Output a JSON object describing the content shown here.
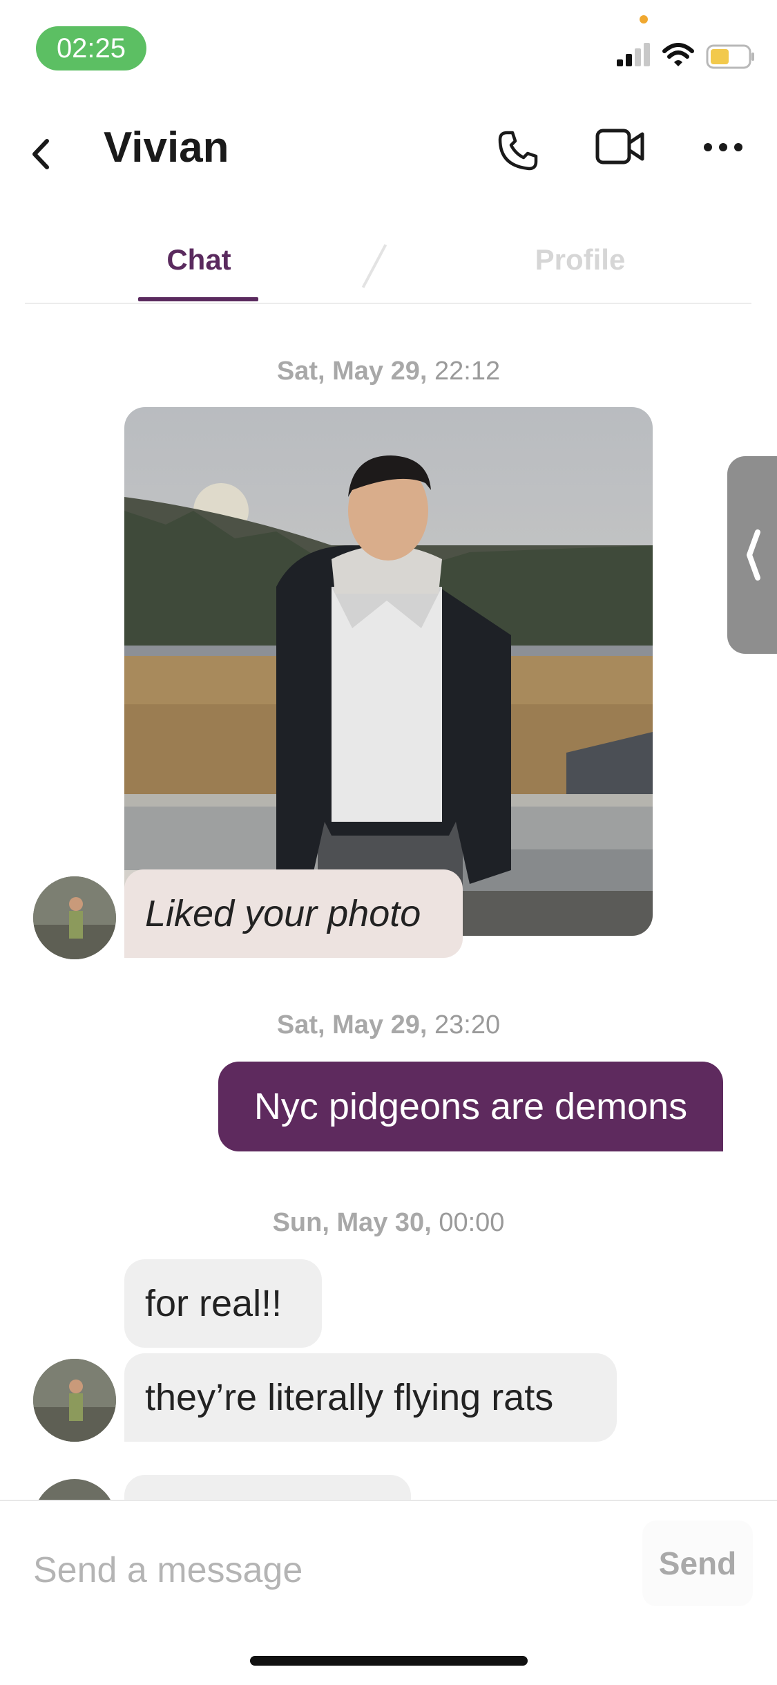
{
  "status_bar": {
    "time": "02:25"
  },
  "header": {
    "title": "Vivian"
  },
  "tabs": [
    {
      "label": "Chat",
      "active": true
    },
    {
      "label": "Profile",
      "active": false
    }
  ],
  "messages": [
    {
      "date": "Sat, May 29,",
      "time": "22:12",
      "type": "liked_photo",
      "text": "Liked your photo"
    },
    {
      "date": "Sat, May 29,",
      "time": "23:20",
      "type": "outgoing",
      "text": "Nyc pidgeons are demons"
    },
    {
      "date": "Sun, May 30,",
      "time": "00:00",
      "type": "incoming",
      "texts": [
        "for real!!",
        "they’re literally flying rats"
      ]
    }
  ],
  "composer": {
    "placeholder": "Send a message",
    "value": "",
    "send_label": "Send"
  },
  "colors": {
    "accent": "#5e2a5e",
    "time_pill": "#5cbf63",
    "incoming_bubble": "#efefef",
    "liked_bubble": "#ede3e0"
  },
  "icons": [
    "back-chevron-icon",
    "phone-icon",
    "video-camera-icon",
    "more-dots-icon",
    "signal-icon",
    "wifi-icon",
    "battery-icon",
    "drawer-chevron-icon"
  ]
}
